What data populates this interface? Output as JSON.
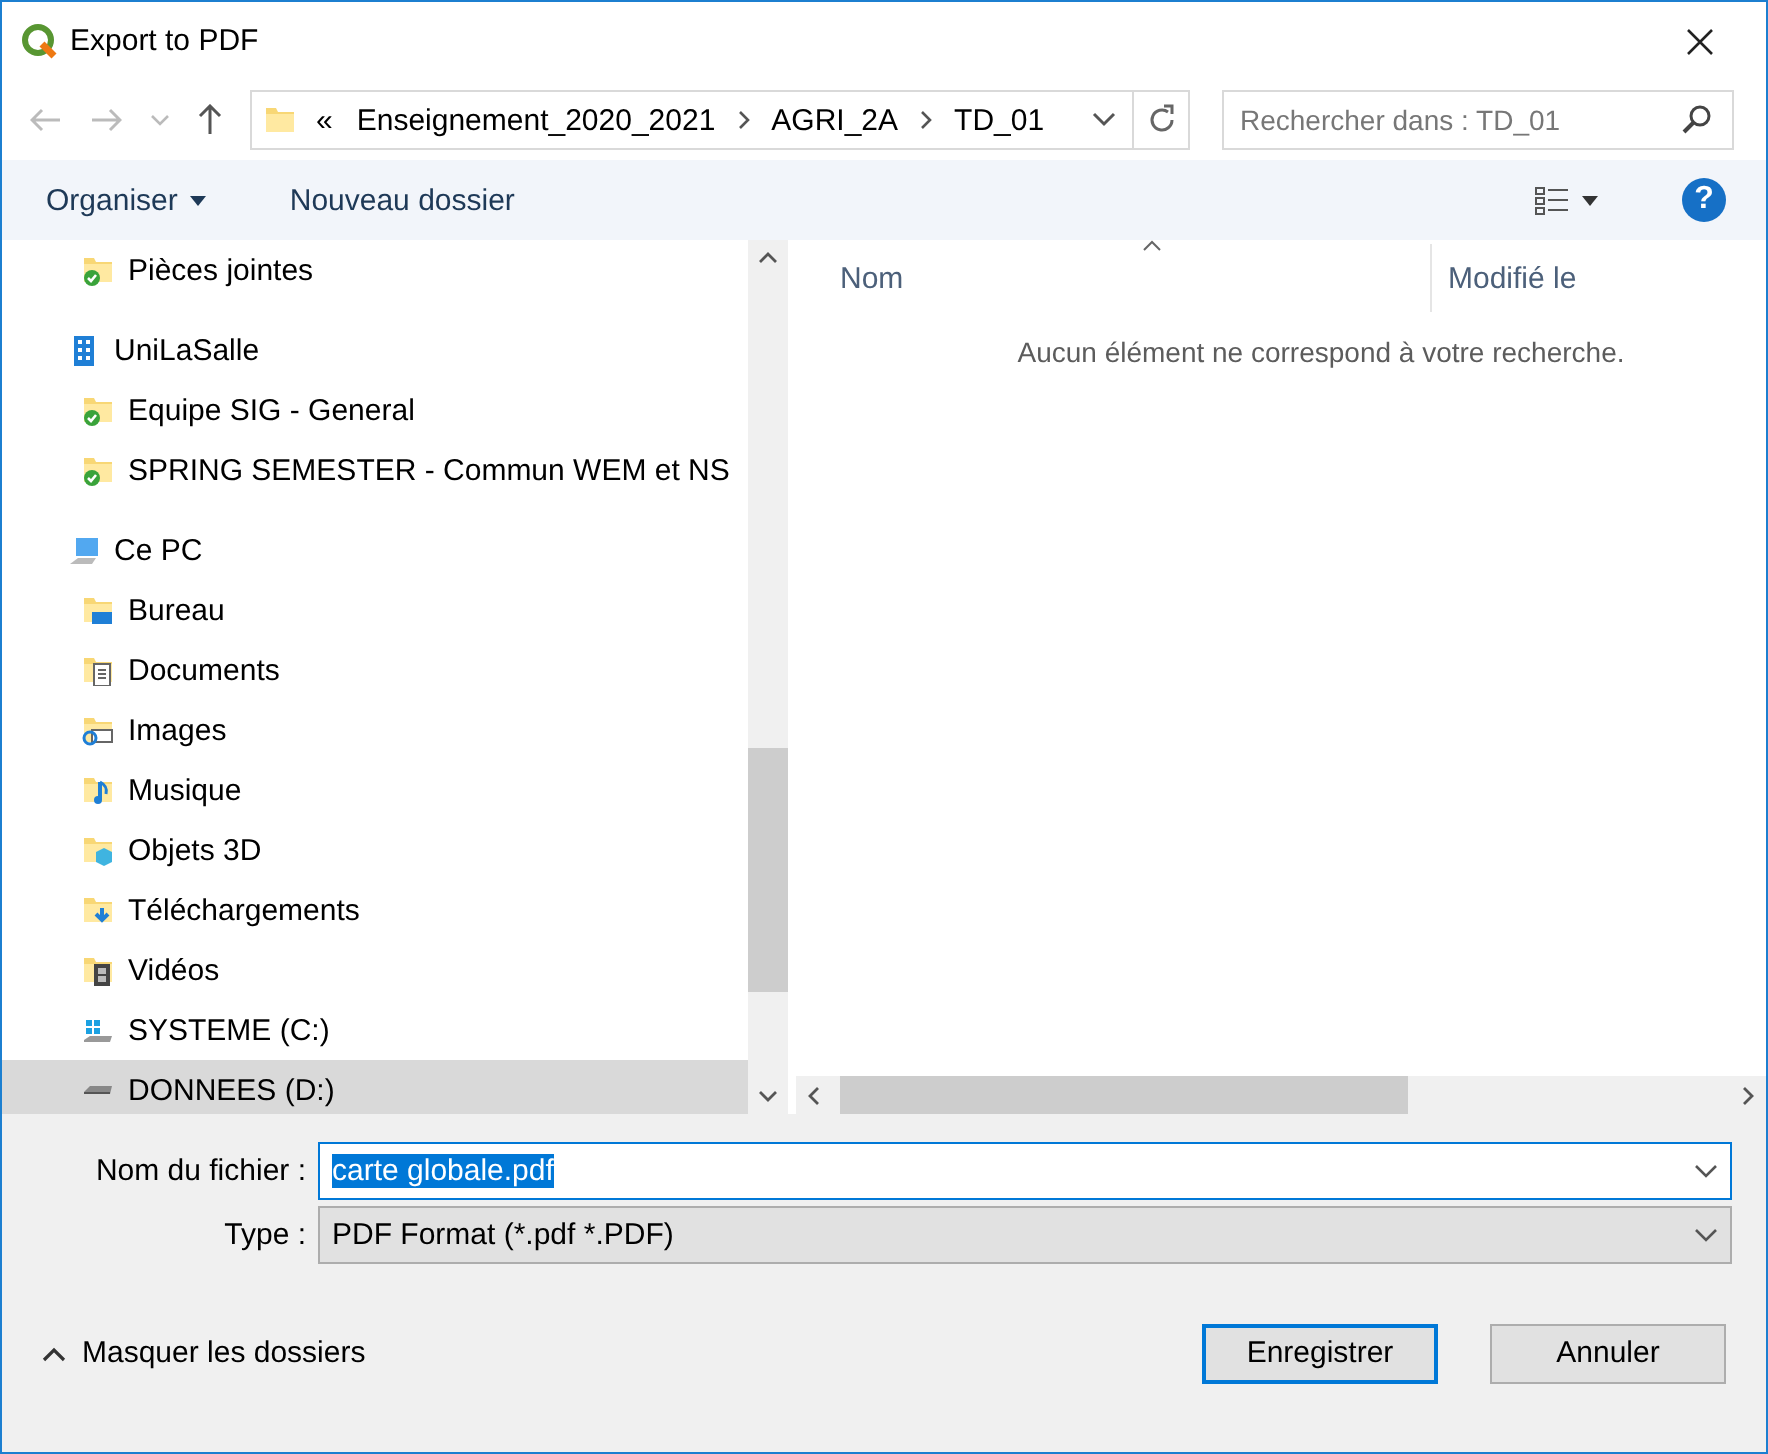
{
  "window": {
    "title": "Export to PDF"
  },
  "nav": {
    "overflow": "«",
    "path": [
      "Enseignement_2020_2021",
      "AGRI_2A",
      "TD_01"
    ],
    "search": {
      "placeholder": "Rechercher dans : TD_01"
    }
  },
  "toolbar": {
    "organize": "Organiser",
    "new_folder": "Nouveau dossier",
    "help": "?"
  },
  "sidebar": {
    "items": [
      {
        "children": [
          {
            "label": "Pièces jointes",
            "kind": "synced-folder",
            "selected": false
          }
        ]
      },
      {
        "label": "UniLaSalle",
        "kind": "organization",
        "selected": false,
        "children": [
          {
            "label": "Equipe SIG - General",
            "kind": "synced-folder",
            "selected": false
          },
          {
            "label": "SPRING SEMESTER - Commun WEM et NS",
            "kind": "synced-folder",
            "selected": false
          }
        ]
      },
      {
        "label": "Ce PC",
        "kind": "computer",
        "selected": false,
        "children": [
          {
            "label": "Bureau",
            "kind": "desktop",
            "selected": false
          },
          {
            "label": "Documents",
            "kind": "documents",
            "selected": false
          },
          {
            "label": "Images",
            "kind": "pictures",
            "selected": false
          },
          {
            "label": "Musique",
            "kind": "music",
            "selected": false
          },
          {
            "label": "Objets 3D",
            "kind": "objects3d",
            "selected": false
          },
          {
            "label": "Téléchargements",
            "kind": "downloads",
            "selected": false
          },
          {
            "label": "Vidéos",
            "kind": "videos",
            "selected": false
          },
          {
            "label": "SYSTEME (C:)",
            "kind": "system-drive",
            "selected": false
          },
          {
            "label": "DONNEES (D:)",
            "kind": "drive",
            "selected": true
          }
        ]
      }
    ]
  },
  "file_list": {
    "columns": [
      {
        "label": "Nom",
        "sorted": true
      },
      {
        "label": "Modifié le",
        "sorted": false
      }
    ],
    "empty_message": "Aucun élément ne correspond à votre recherche."
  },
  "form": {
    "filename_label": "Nom du fichier :",
    "filename": "carte globale.pdf",
    "filename_selected": true,
    "type_label": "Type :",
    "type": "PDF Format (*.pdf *.PDF)"
  },
  "footer": {
    "toggle": "Masquer les dossiers",
    "buttons": [
      {
        "label": "Enregistrer",
        "default": true
      },
      {
        "label": "Annuler",
        "default": false
      }
    ]
  }
}
